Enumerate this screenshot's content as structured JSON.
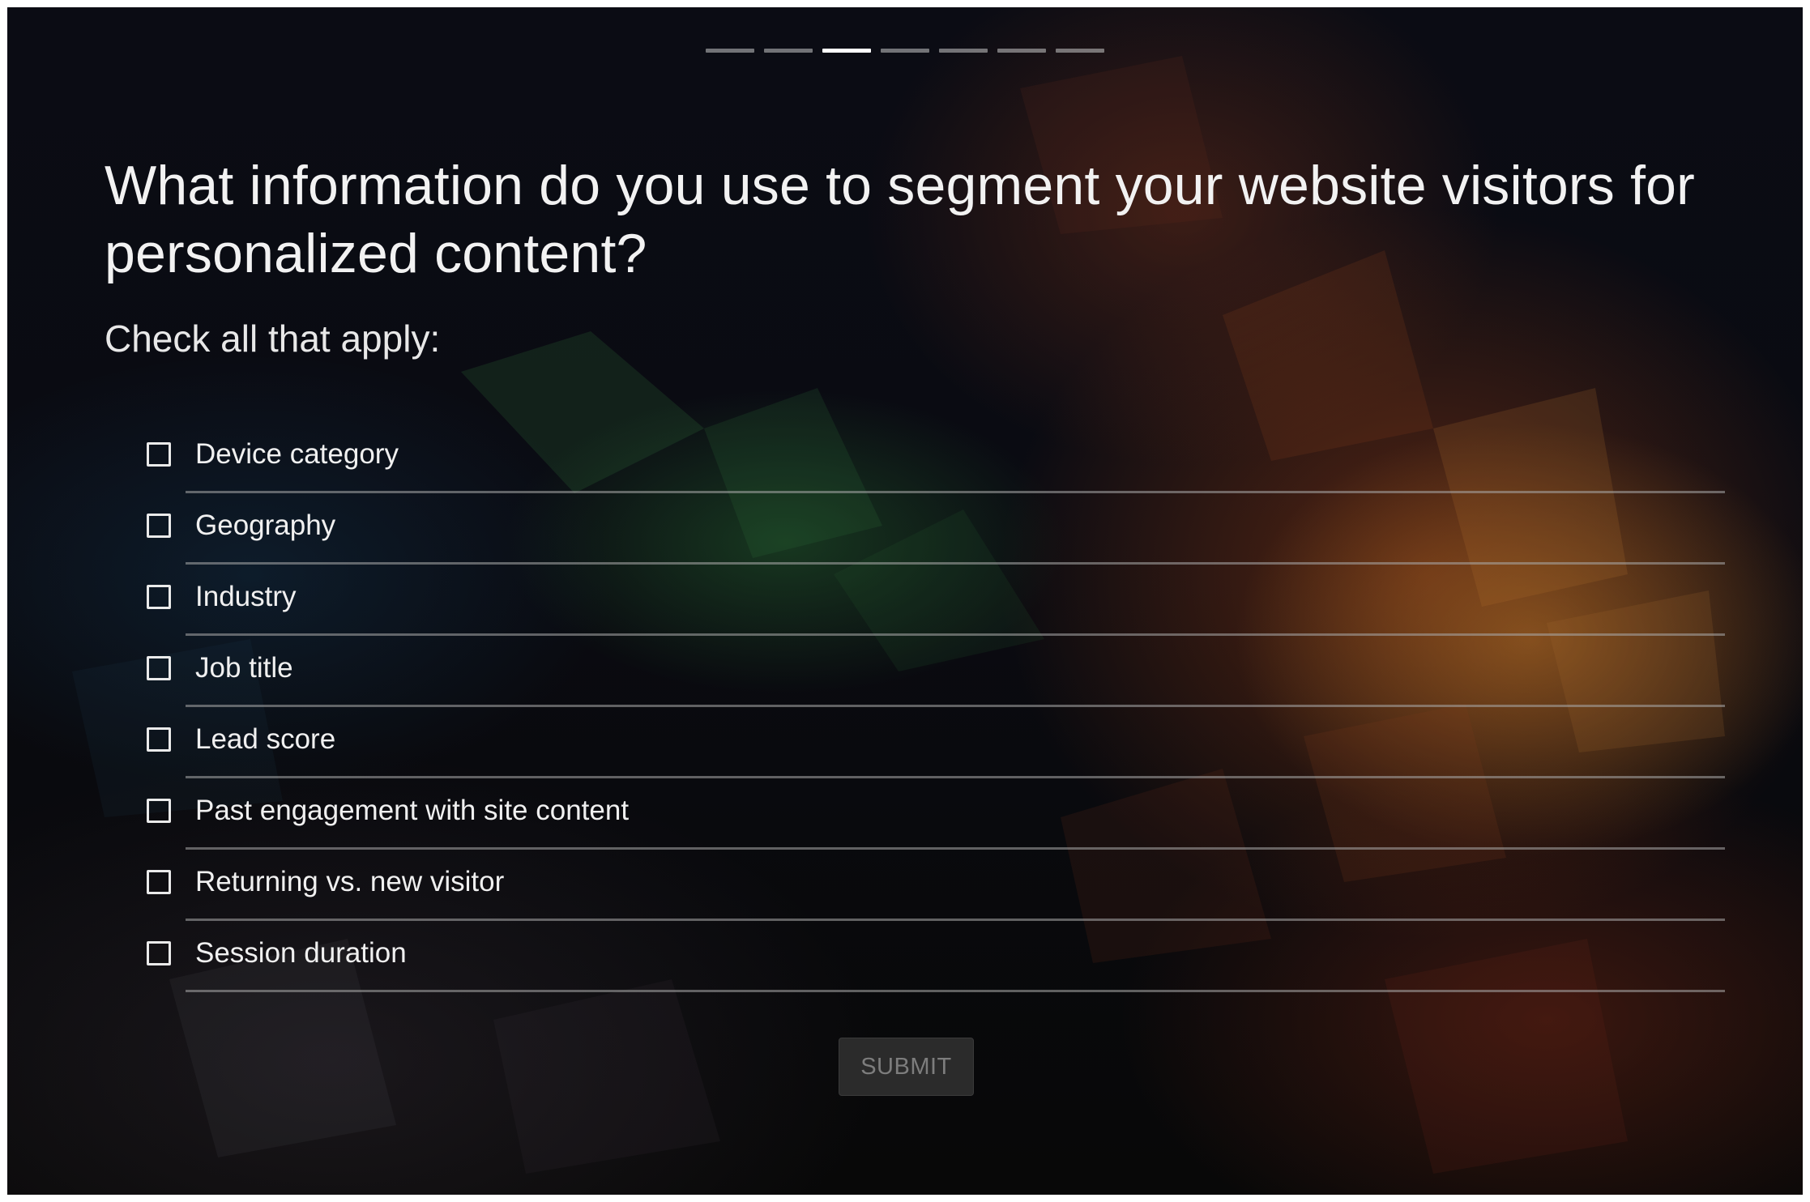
{
  "progress": {
    "total_steps": 7,
    "current_step": 3
  },
  "question": {
    "title": "What information do you use to segment your website visitors for personalized content?",
    "instructions": "Check all that apply:"
  },
  "options": [
    {
      "label": "Device category",
      "checked": false
    },
    {
      "label": "Geography",
      "checked": false
    },
    {
      "label": "Industry",
      "checked": false
    },
    {
      "label": "Job title",
      "checked": false
    },
    {
      "label": "Lead score",
      "checked": false
    },
    {
      "label": "Past engagement with site content",
      "checked": false
    },
    {
      "label": "Returning vs. new visitor",
      "checked": false
    },
    {
      "label": "Session duration",
      "checked": false
    }
  ],
  "submit": {
    "label": "SUBMIT",
    "enabled": false
  }
}
